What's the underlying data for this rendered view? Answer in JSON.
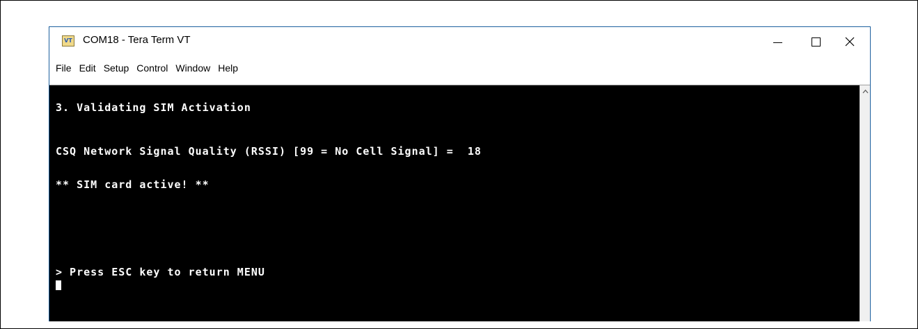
{
  "window": {
    "icon_text": "VT",
    "title": "COM18 - Tera Term VT",
    "controls": {
      "minimize": "—",
      "maximize": "☐",
      "close": "✕"
    }
  },
  "menu": [
    "File",
    "Edit",
    "Setup",
    "Control",
    "Window",
    "Help"
  ],
  "terminal": {
    "lines": [
      "3. Validating SIM Activation",
      "CSQ Network Signal Quality (RSSI) [99 = No Cell Signal] =  18",
      "** SIM card active! **",
      "> Press ESC key to return MENU"
    ]
  },
  "scrollbar": {
    "up_arrow": "^"
  },
  "colors": {
    "terminal_bg": "#000000",
    "terminal_fg": "#ffffff",
    "window_border": "#1c5f9e"
  }
}
